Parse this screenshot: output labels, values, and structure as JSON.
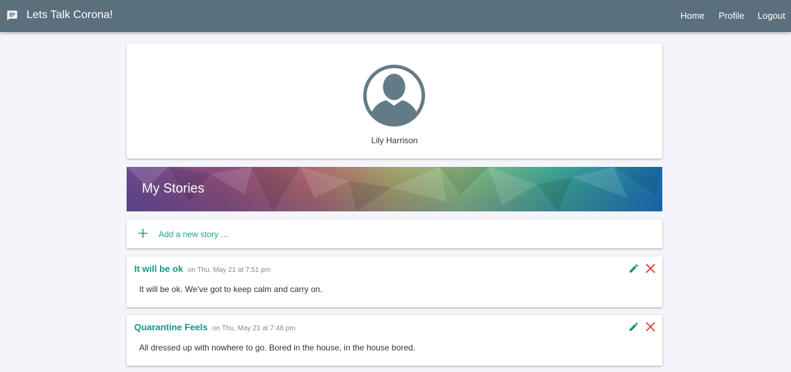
{
  "app": {
    "title": "Lets Talk Corona!",
    "icon": "chat-icon"
  },
  "nav": {
    "items": [
      {
        "label": "Home"
      },
      {
        "label": "Profile"
      },
      {
        "label": "Logout"
      }
    ]
  },
  "profile": {
    "name": "Lily Harrison",
    "avatar_icon": "account-circle-icon"
  },
  "section": {
    "title": "My Stories"
  },
  "add_story": {
    "label": "Add a new story ...",
    "icon": "plus-icon"
  },
  "stories": [
    {
      "title": "It will be ok",
      "date": "on Thu, May 21 at 7:51 pm",
      "body": "It will be ok. We've got to keep calm and carry on."
    },
    {
      "title": "Quarantine Feels",
      "date": "on Thu, May 21 at 7:48 pm",
      "body": "All dressed up with nowhere to go. Bored in the house, in the house bored."
    }
  ],
  "colors": {
    "navbar": "#5a707c",
    "accent": "#179482",
    "delete": "#e53935",
    "background": "#f3f5fa"
  }
}
